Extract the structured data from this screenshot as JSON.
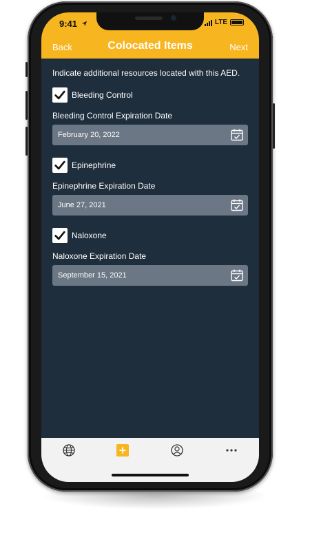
{
  "status_bar": {
    "time": "9:41",
    "network": "LTE"
  },
  "header": {
    "back_label": "Back",
    "title": "Colocated Items",
    "next_label": "Next",
    "color": "#f7b520"
  },
  "intro_text": "Indicate additional resources located with this AED.",
  "items": [
    {
      "label": "Bleeding Control",
      "checked": true,
      "date_label": "Bleeding Control Expiration Date",
      "date_value": "February 20, 2022"
    },
    {
      "label": "Epinephrine",
      "checked": true,
      "date_label": "Epinephrine Expiration Date",
      "date_value": "June 27, 2021"
    },
    {
      "label": "Naloxone",
      "checked": true,
      "date_label": "Naloxone Expiration Date",
      "date_value": "September 15, 2021"
    }
  ],
  "tab_bar": {
    "tabs": [
      {
        "icon": "globe-icon"
      },
      {
        "icon": "add-icon",
        "active": true
      },
      {
        "icon": "user-icon"
      },
      {
        "icon": "more-icon"
      }
    ],
    "accent": "#f7b520"
  },
  "colors": {
    "background": "#1f2e3d",
    "field": "#6b7784"
  }
}
